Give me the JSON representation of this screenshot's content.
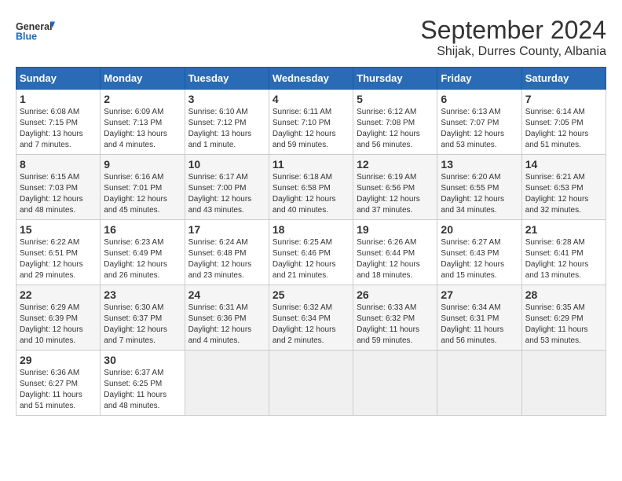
{
  "logo": {
    "general": "General",
    "blue": "Blue"
  },
  "title": "September 2024",
  "location": "Shijak, Durres County, Albania",
  "days_header": [
    "Sunday",
    "Monday",
    "Tuesday",
    "Wednesday",
    "Thursday",
    "Friday",
    "Saturday"
  ],
  "weeks": [
    [
      {
        "day": "1",
        "sunrise": "6:08 AM",
        "sunset": "7:15 PM",
        "daylight": "13 hours and 7 minutes."
      },
      {
        "day": "2",
        "sunrise": "6:09 AM",
        "sunset": "7:13 PM",
        "daylight": "13 hours and 4 minutes."
      },
      {
        "day": "3",
        "sunrise": "6:10 AM",
        "sunset": "7:12 PM",
        "daylight": "13 hours and 1 minute."
      },
      {
        "day": "4",
        "sunrise": "6:11 AM",
        "sunset": "7:10 PM",
        "daylight": "12 hours and 59 minutes."
      },
      {
        "day": "5",
        "sunrise": "6:12 AM",
        "sunset": "7:08 PM",
        "daylight": "12 hours and 56 minutes."
      },
      {
        "day": "6",
        "sunrise": "6:13 AM",
        "sunset": "7:07 PM",
        "daylight": "12 hours and 53 minutes."
      },
      {
        "day": "7",
        "sunrise": "6:14 AM",
        "sunset": "7:05 PM",
        "daylight": "12 hours and 51 minutes."
      }
    ],
    [
      {
        "day": "8",
        "sunrise": "6:15 AM",
        "sunset": "7:03 PM",
        "daylight": "12 hours and 48 minutes."
      },
      {
        "day": "9",
        "sunrise": "6:16 AM",
        "sunset": "7:01 PM",
        "daylight": "12 hours and 45 minutes."
      },
      {
        "day": "10",
        "sunrise": "6:17 AM",
        "sunset": "7:00 PM",
        "daylight": "12 hours and 43 minutes."
      },
      {
        "day": "11",
        "sunrise": "6:18 AM",
        "sunset": "6:58 PM",
        "daylight": "12 hours and 40 minutes."
      },
      {
        "day": "12",
        "sunrise": "6:19 AM",
        "sunset": "6:56 PM",
        "daylight": "12 hours and 37 minutes."
      },
      {
        "day": "13",
        "sunrise": "6:20 AM",
        "sunset": "6:55 PM",
        "daylight": "12 hours and 34 minutes."
      },
      {
        "day": "14",
        "sunrise": "6:21 AM",
        "sunset": "6:53 PM",
        "daylight": "12 hours and 32 minutes."
      }
    ],
    [
      {
        "day": "15",
        "sunrise": "6:22 AM",
        "sunset": "6:51 PM",
        "daylight": "12 hours and 29 minutes."
      },
      {
        "day": "16",
        "sunrise": "6:23 AM",
        "sunset": "6:49 PM",
        "daylight": "12 hours and 26 minutes."
      },
      {
        "day": "17",
        "sunrise": "6:24 AM",
        "sunset": "6:48 PM",
        "daylight": "12 hours and 23 minutes."
      },
      {
        "day": "18",
        "sunrise": "6:25 AM",
        "sunset": "6:46 PM",
        "daylight": "12 hours and 21 minutes."
      },
      {
        "day": "19",
        "sunrise": "6:26 AM",
        "sunset": "6:44 PM",
        "daylight": "12 hours and 18 minutes."
      },
      {
        "day": "20",
        "sunrise": "6:27 AM",
        "sunset": "6:43 PM",
        "daylight": "12 hours and 15 minutes."
      },
      {
        "day": "21",
        "sunrise": "6:28 AM",
        "sunset": "6:41 PM",
        "daylight": "12 hours and 13 minutes."
      }
    ],
    [
      {
        "day": "22",
        "sunrise": "6:29 AM",
        "sunset": "6:39 PM",
        "daylight": "12 hours and 10 minutes."
      },
      {
        "day": "23",
        "sunrise": "6:30 AM",
        "sunset": "6:37 PM",
        "daylight": "12 hours and 7 minutes."
      },
      {
        "day": "24",
        "sunrise": "6:31 AM",
        "sunset": "6:36 PM",
        "daylight": "12 hours and 4 minutes."
      },
      {
        "day": "25",
        "sunrise": "6:32 AM",
        "sunset": "6:34 PM",
        "daylight": "12 hours and 2 minutes."
      },
      {
        "day": "26",
        "sunrise": "6:33 AM",
        "sunset": "6:32 PM",
        "daylight": "11 hours and 59 minutes."
      },
      {
        "day": "27",
        "sunrise": "6:34 AM",
        "sunset": "6:31 PM",
        "daylight": "11 hours and 56 minutes."
      },
      {
        "day": "28",
        "sunrise": "6:35 AM",
        "sunset": "6:29 PM",
        "daylight": "11 hours and 53 minutes."
      }
    ],
    [
      {
        "day": "29",
        "sunrise": "6:36 AM",
        "sunset": "6:27 PM",
        "daylight": "11 hours and 51 minutes."
      },
      {
        "day": "30",
        "sunrise": "6:37 AM",
        "sunset": "6:25 PM",
        "daylight": "11 hours and 48 minutes."
      },
      null,
      null,
      null,
      null,
      null
    ]
  ]
}
